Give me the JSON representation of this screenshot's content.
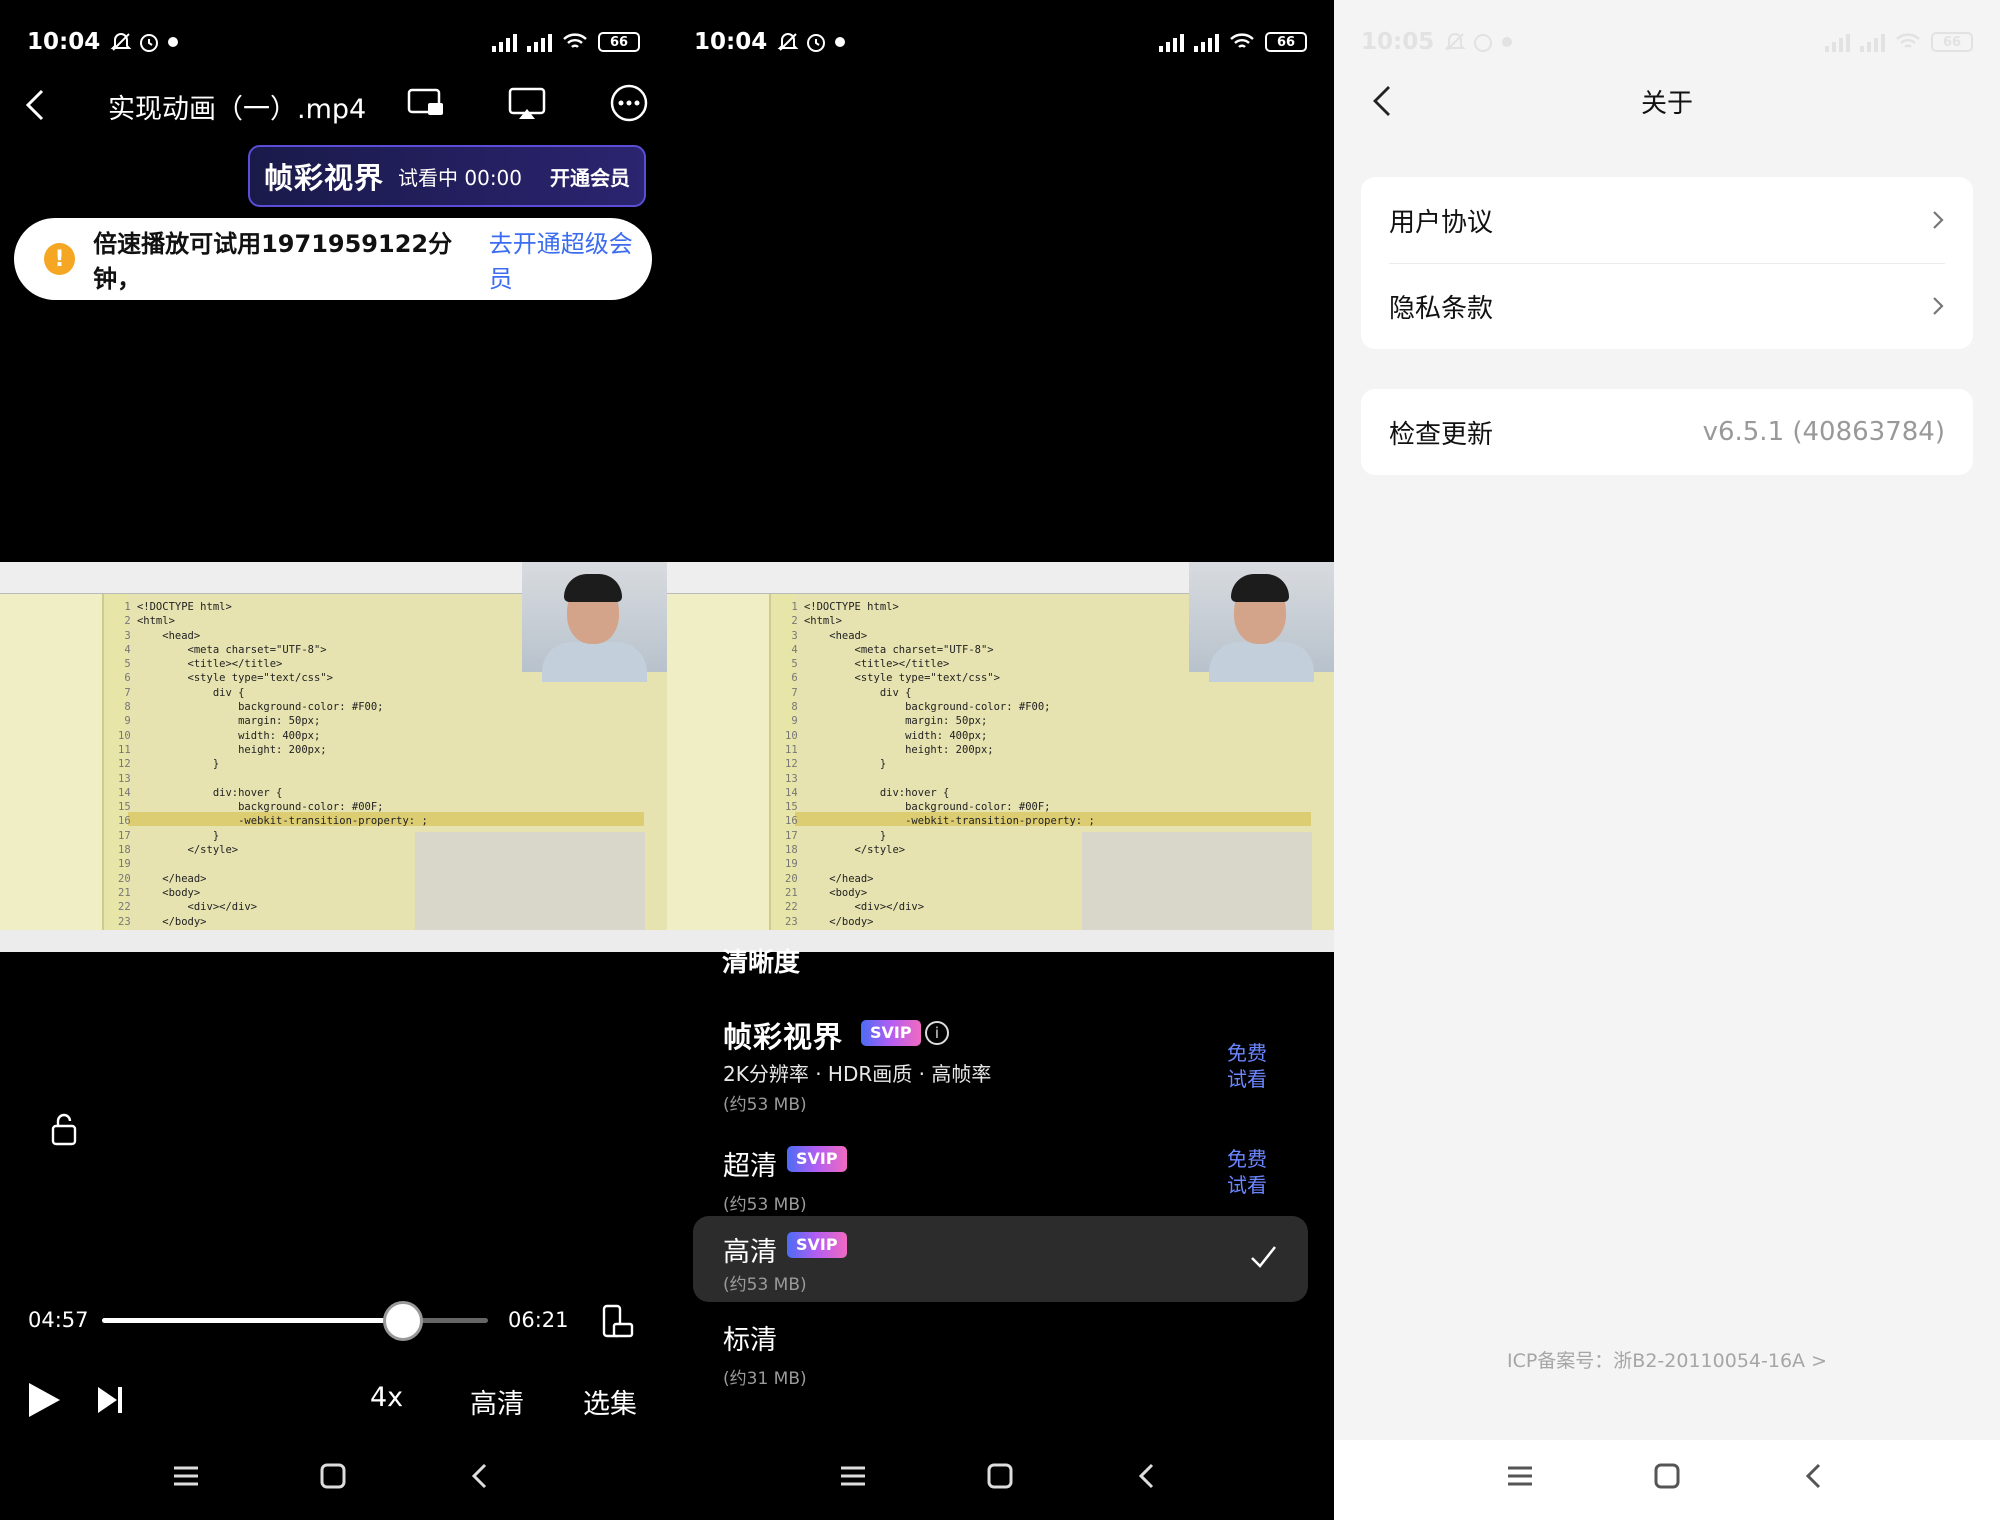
{
  "player": {
    "status": {
      "time": "10:04",
      "battery": "66"
    },
    "title": "实现动画（一）.mp4",
    "svip_bar": {
      "brand": "帧彩视界",
      "trial": "试看中 00:00",
      "cta": "开通会员"
    },
    "toast": {
      "text": "倍速播放可试用1971959122分钟，",
      "link": "去开通超级会员"
    },
    "elapsed": "04:57",
    "duration": "06:21",
    "progress_fraction": 0.78,
    "controls": {
      "speed": "4x",
      "quality": "高清",
      "episodes": "选集"
    }
  },
  "code_lines": [
    "<!DOCTYPE html>",
    "<html>",
    "    <head>",
    "        <meta charset=\"UTF-8\">",
    "        <title></title>",
    "        <style type=\"text/css\">",
    "            div {",
    "                background-color: #F00;",
    "                margin: 50px;",
    "                width: 400px;",
    "                height: 200px;",
    "            }",
    "",
    "            div:hover {",
    "                background-color: #00F;",
    "                -webkit-transition-property: ;",
    "            }",
    "        </style>",
    "",
    "    </head>",
    "    <body>",
    "        <div></div>",
    "    </body>"
  ],
  "quality_sheet": {
    "status": {
      "time": "10:04",
      "battery": "66"
    },
    "title": "清晰度",
    "items": [
      {
        "name": "帧彩视界",
        "badge": "SVIP",
        "features": "2K分辨率 · HDR画质 · 高帧率",
        "size": "(约53 MB)",
        "free": "免费试看"
      },
      {
        "name": "超清",
        "badge": "SVIP",
        "size": "(约53 MB)",
        "free": "免费试看"
      },
      {
        "name": "高清",
        "badge": "SVIP",
        "size": "(约53 MB)",
        "selected": true
      },
      {
        "name": "标清",
        "size": "(约31 MB)"
      }
    ]
  },
  "about": {
    "status": {
      "time": "10:05",
      "battery": "66"
    },
    "title": "关于",
    "links": [
      "用户协议",
      "隐私条款"
    ],
    "update_label": "检查更新",
    "version": "v6.5.1 (40863784)",
    "icp": "ICP备案号：浙B2-20110054-16A >"
  },
  "colors": {
    "accent_blue": "#3c6cf0",
    "free_text": "#6b86ff",
    "warning": "#f5a623"
  }
}
